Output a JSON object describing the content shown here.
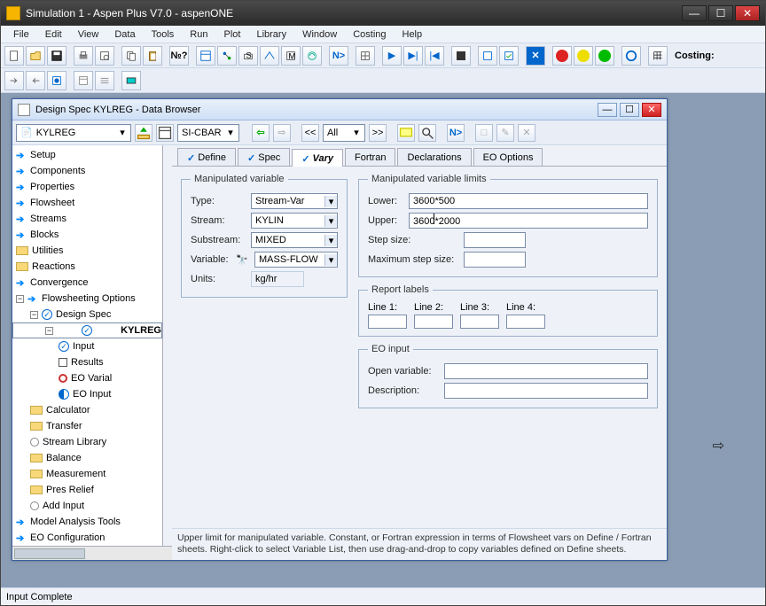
{
  "main_title": "Simulation 1 - Aspen Plus V7.0 - aspenONE",
  "menus": [
    "File",
    "Edit",
    "View",
    "Data",
    "Tools",
    "Run",
    "Plot",
    "Library",
    "Window",
    "Costing",
    "Help"
  ],
  "toolbar_costing": "Costing:",
  "child_title": "Design Spec KYLREG - Data Browser",
  "child_toolbar": {
    "nav_combo": "KYLREG",
    "units_combo": "SI-CBAR",
    "scope_combo": "All",
    "next_btn": "N>",
    "dbl_left": "<<",
    "dbl_right": ">>"
  },
  "tree": {
    "setup": "Setup",
    "components": "Components",
    "properties": "Properties",
    "flowsheet": "Flowsheet",
    "streams": "Streams",
    "blocks": "Blocks",
    "utilities": "Utilities",
    "reactions": "Reactions",
    "convergence": "Convergence",
    "fso": "Flowsheeting Options",
    "design_spec": "Design Spec",
    "kylreg": "KYLREG",
    "input": "Input",
    "results": "Results",
    "eo_var": "EO Varial",
    "eo_input": "EO Input",
    "calculator": "Calculator",
    "transfer": "Transfer",
    "stream_lib": "Stream Library",
    "balance": "Balance",
    "measurement": "Measurement",
    "pres_relief": "Pres Relief",
    "add_input": "Add Input",
    "mat": "Model Analysis Tools",
    "eo_config": "EO Configuration"
  },
  "tabs": {
    "define": "Define",
    "spec": "Spec",
    "vary": "Vary",
    "fortran": "Fortran",
    "declarations": "Declarations",
    "eo_options": "EO Options"
  },
  "manip": {
    "legend": "Manipulated variable",
    "type_l": "Type:",
    "type_v": "Stream-Var",
    "stream_l": "Stream:",
    "stream_v": "KYLIN",
    "substream_l": "Substream:",
    "substream_v": "MIXED",
    "variable_l": "Variable:",
    "variable_v": "MASS-FLOW",
    "units_l": "Units:",
    "units_v": "kg/hr"
  },
  "limits": {
    "legend": "Manipulated variable limits",
    "lower_l": "Lower:",
    "lower_v": "3600*500",
    "upper_l": "Upper:",
    "upper_v": "3600*2000",
    "step_l": "Step size:",
    "maxstep_l": "Maximum step size:"
  },
  "report": {
    "legend": "Report labels",
    "l1": "Line 1:",
    "l2": "Line 2:",
    "l3": "Line 3:",
    "l4": "Line 4:"
  },
  "eo": {
    "legend": "EO input",
    "open_l": "Open variable:",
    "desc_l": "Description:"
  },
  "help_text": "Upper limit for manipulated variable. Constant, or Fortran expression in terms of Flowsheet vars on Define / Fortran sheets. Right-click to select Variable List, then use drag-and-drop to copy variables defined on Define sheets.",
  "status": "Input Complete"
}
